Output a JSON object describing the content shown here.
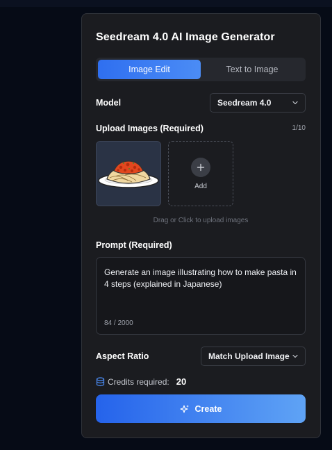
{
  "panel": {
    "title": "Seedream 4.0 AI Image Generator"
  },
  "tabs": [
    {
      "label": "Image Edit",
      "active": true
    },
    {
      "label": "Text to Image",
      "active": false
    }
  ],
  "model": {
    "label": "Model",
    "selected": "Seedream 4.0"
  },
  "upload": {
    "label": "Upload Images (Required)",
    "counter": "1/10",
    "add_label": "Add",
    "hint": "Drag or Click to upload images",
    "images": [
      {
        "icon": "pasta-plate-image"
      }
    ]
  },
  "prompt": {
    "label": "Prompt (Required)",
    "value": "Generate an image illustrating how to make pasta in 4 steps (explained in Japanese)",
    "count": "84 / 2000"
  },
  "aspect_ratio": {
    "label": "Aspect Ratio",
    "selected": "Match Upload Image"
  },
  "credits": {
    "label": "Credits required:",
    "value": "20"
  },
  "create_button": {
    "label": "Create"
  },
  "colors": {
    "accent": "#2f6ff0",
    "panel_bg": "#1b1c20",
    "page_bg": "#060b16"
  }
}
